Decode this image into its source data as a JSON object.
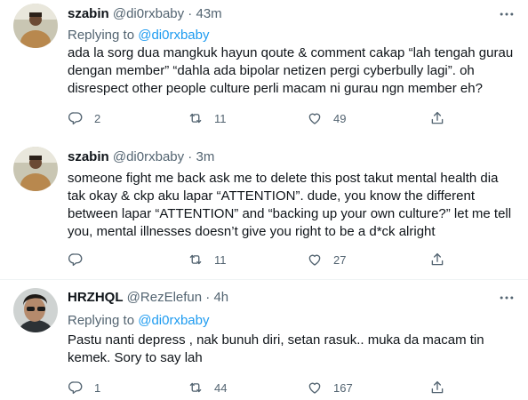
{
  "tweets": [
    {
      "name": "szabin",
      "handle": "@di0rxbaby",
      "time": "43m",
      "replying_prefix": "Replying to",
      "replying_to": "@di0rxbaby",
      "text": "ada la sorg dua mangkuk hayun qoute & comment cakap “lah tengah gurau\ndengan member” “dahla ada bipolar netizen pergi cyberbully lagi”. oh\ndisrespect other people culture perli macam ni gurau ngn member eh?",
      "replies": "2",
      "retweets": "11",
      "likes": "49"
    },
    {
      "name": "szabin",
      "handle": "@di0rxbaby",
      "time": "3m",
      "text": "someone fight me back ask me to delete this post takut mental health dia\ntak okay & ckp aku lapar “ATTENTION”. dude, you know the different\nbetween lapar “ATTENTION” and “backing up your own culture?” let me tell\nyou, mental illnesses doesn’t give you right to be a d*ck alright",
      "replies": "",
      "retweets": "11",
      "likes": "27"
    },
    {
      "name": "HRZHQL",
      "handle": "@RezElefun",
      "time": "4h",
      "replying_prefix": "Replying to",
      "replying_to": "@di0rxbaby",
      "text": "Pastu nanti depress , nak bunuh diri, setan rasuk.. muka da macam tin\nkemek. Sory to say lah",
      "replies": "1",
      "retweets": "44",
      "likes": "167"
    }
  ],
  "separator": " · ",
  "colors": {
    "accent": "#1d9bf0",
    "muted": "#536471",
    "text": "#0f1419"
  },
  "icons": [
    "reply-icon",
    "retweet-icon",
    "like-icon",
    "share-icon",
    "more-icon"
  ]
}
